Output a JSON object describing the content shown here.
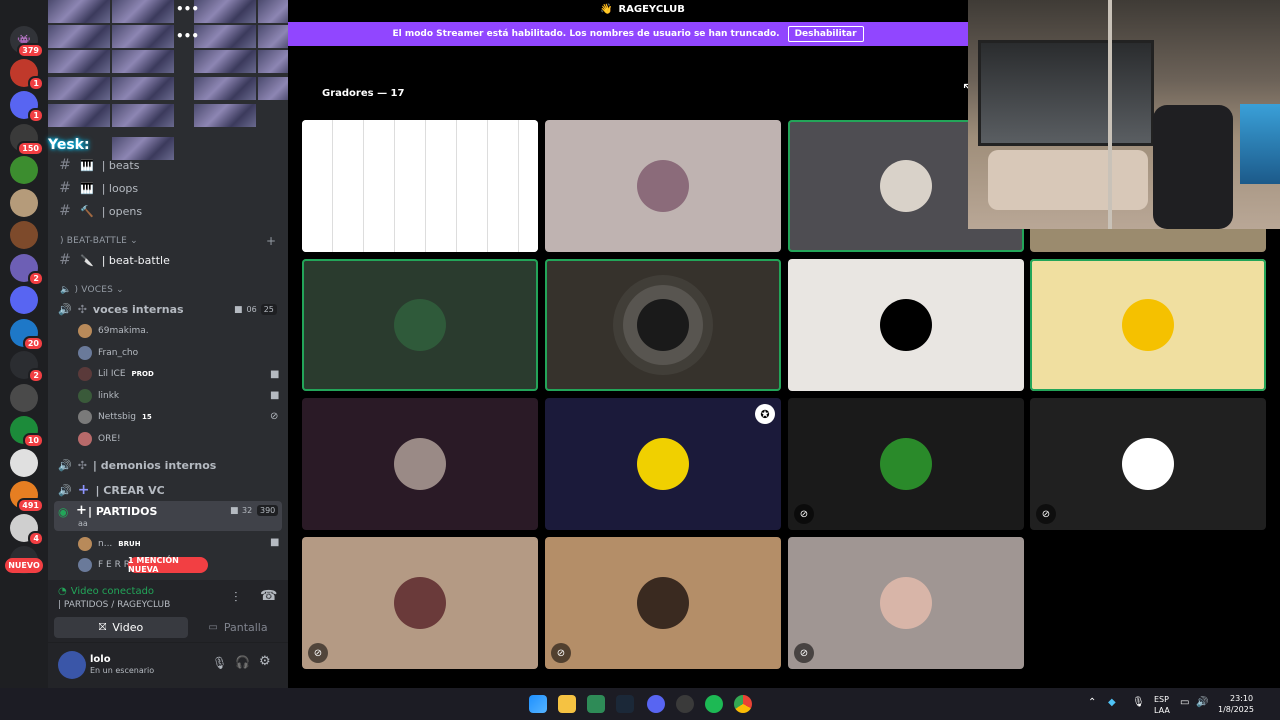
{
  "server_rail": {
    "servers": [
      {
        "name": "discord-home",
        "color": "#313338",
        "glyph": "👾",
        "badge": "379"
      },
      {
        "name": "server-red",
        "color": "#c0392b",
        "glyph": "",
        "badge": "1"
      },
      {
        "name": "server-discord",
        "color": "#5865f2",
        "glyph": "",
        "badge": "1"
      },
      {
        "name": "server-skull",
        "color": "#3a3a3a",
        "glyph": "",
        "badge": "150"
      },
      {
        "name": "server-pepe",
        "color": "#3c8d2f",
        "glyph": "",
        "badge": ""
      },
      {
        "name": "server-face",
        "color": "#b59b7a",
        "glyph": "",
        "badge": ""
      },
      {
        "name": "server-game",
        "color": "#7d4a2b",
        "glyph": "",
        "badge": ""
      },
      {
        "name": "server-dice",
        "color": "#6d5fb5",
        "glyph": "",
        "badge": "2"
      },
      {
        "name": "server-white",
        "color": "#5865f2",
        "glyph": "",
        "badge": ""
      },
      {
        "name": "server-blue",
        "color": "#1e78c8",
        "glyph": "",
        "badge": "20"
      },
      {
        "name": "server-sound",
        "color": "#2b2d31",
        "glyph": "",
        "badge": "2"
      },
      {
        "name": "server-fox",
        "color": "#4a4a4a",
        "glyph": "",
        "badge": ""
      },
      {
        "name": "server-green",
        "color": "#1c8b3a",
        "glyph": "",
        "badge": "10"
      },
      {
        "name": "server-troll",
        "color": "#e0e0e0",
        "glyph": "",
        "badge": ""
      },
      {
        "name": "server-orange",
        "color": "#e67e22",
        "glyph": "",
        "badge": "491"
      },
      {
        "name": "server-dog",
        "color": "#cfcfcf",
        "glyph": "",
        "badge": "4"
      },
      {
        "name": "server-hair",
        "color": "#2b2d31",
        "glyph": "",
        "badge": ""
      }
    ],
    "new_label": "NUEVO"
  },
  "sidebar": {
    "text_channels": [
      {
        "icon": "🎹",
        "label": "| beats"
      },
      {
        "icon": "🎹",
        "label": "| loops"
      },
      {
        "icon": "🔨",
        "label": "| opens"
      }
    ],
    "cat_beat_battle": ") BEAT-BATTLE",
    "beat_battle_channel": {
      "icon": "🔪",
      "label": "| beat-battle"
    },
    "cat_voces": ") VOCES",
    "voice_channel_1": {
      "label": "voces internas",
      "cam_count": "06",
      "user_count": "25"
    },
    "voice_users_1": [
      {
        "name": "69makima.",
        "tag": ""
      },
      {
        "name": "Fran_cho",
        "tag": ""
      },
      {
        "name": "Lil ICE",
        "tag": "PROD"
      },
      {
        "name": "linkk",
        "tag": ""
      },
      {
        "name": "Nettsbig",
        "tag": "15"
      },
      {
        "name": "ORE!",
        "tag": ""
      }
    ],
    "voice_channel_2": {
      "label": "| demonios internos"
    },
    "voice_channel_3": {
      "label": "| CREAR VC"
    },
    "voice_channel_4": {
      "label": "| PARTIDOS",
      "sub": "aa",
      "cam_count": "32",
      "user_count": "390"
    },
    "voice_users_4": [
      {
        "name": "n...",
        "tag": "BRUH"
      },
      {
        "name": "F E R R",
        "tag": ""
      }
    ],
    "mention_label": "1 MENCIÓN NUEVA",
    "overlay_name": "Yesk:",
    "voice_status": "Video conectado",
    "voice_location": "| PARTIDOS / RAGEYCLUB",
    "video_button": "Video",
    "screen_button": "Pantalla",
    "user": {
      "name": "lolo",
      "status": "En un escenario"
    }
  },
  "main": {
    "server_title": "RAGEYCLUB",
    "banner_text": "El modo Streamer está habilitado. Los nombres de usuario se han truncado.",
    "banner_button": "Deshabilitar",
    "section_title": "Gradores — 17",
    "tiles": [
      {
        "bg": "#ffffff",
        "av": "#ffffff",
        "muted": false
      },
      {
        "bg": "#bfb3b1",
        "av": "#8b6b7a",
        "muted": false
      },
      {
        "bg": "#4e4d52",
        "av": "#d9d2c9",
        "muted": false
      },
      {
        "bg": "#9b8b6e",
        "av": "#9fb06a",
        "muted": false
      },
      {
        "bg": "#2a3b2e",
        "av": "#2f5a3a",
        "muted": false
      },
      {
        "bg": "#36322c",
        "av": "#1a1a1a",
        "muted": false
      },
      {
        "bg": "#e9e6e2",
        "av": "#000000",
        "muted": false
      },
      {
        "bg": "#f0dfa0",
        "av": "#f5c100",
        "muted": false
      },
      {
        "bg": "#2a1a26",
        "av": "#9a8a86",
        "muted": false
      },
      {
        "bg": "#1b1a3a",
        "av": "#f0d000",
        "muted": false
      },
      {
        "bg": "#1a1a1a",
        "av": "#2a8a2a",
        "muted": true
      },
      {
        "bg": "#202020",
        "av": "#ffffff",
        "muted": true
      },
      {
        "bg": "#b49a84",
        "av": "#6a3a3a",
        "muted": true
      },
      {
        "bg": "#b48e68",
        "av": "#3a2a20",
        "muted": true
      },
      {
        "bg": "#a09693",
        "av": "#d8b5a8",
        "muted": true
      }
    ]
  },
  "taskbar": {
    "lang_top": "ESP",
    "lang_bottom": "LAA",
    "time": "23:10",
    "date": "1/8/2025"
  },
  "colors": {
    "accent": "#9146ff",
    "green": "#23a559",
    "red": "#f23f43"
  }
}
